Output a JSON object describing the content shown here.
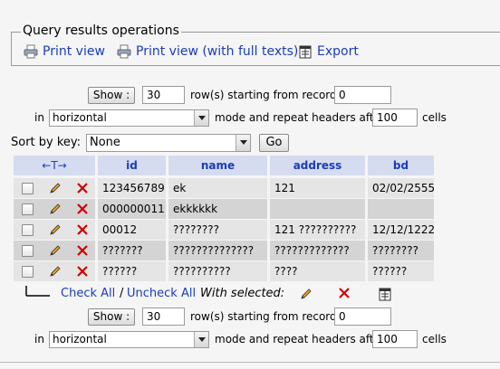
{
  "operations": {
    "legend": "Query results operations",
    "print_view": "Print view",
    "print_full": "Print view (with full texts)",
    "export": "Export"
  },
  "nav_top": {
    "show_label": "Show :",
    "rows_value": "30",
    "starting_text": "row(s) starting from record #",
    "start_value": "0",
    "in_text": "in",
    "mode_value": "horizontal",
    "mode_text": "mode and repeat headers after",
    "repeat_value": "100",
    "cells_text": "cells"
  },
  "sort": {
    "label": "Sort by key:",
    "value": "None",
    "go_label": "Go"
  },
  "table": {
    "headers": [
      "id",
      "name",
      "address",
      "bd"
    ],
    "rows": [
      [
        "123456789",
        "ek",
        "121",
        "02/02/2555"
      ],
      [
        "000000011",
        "ekkkkkk",
        "",
        ""
      ],
      [
        "00012",
        "????????",
        "121 ??????????",
        "12/12/1222"
      ],
      [
        "???????",
        "??????????????",
        "?????????????",
        "????????"
      ],
      [
        "??????",
        "??????????",
        "????",
        "??????"
      ]
    ]
  },
  "footer": {
    "check_all": "Check All",
    "separator": "/",
    "uncheck_all": "Uncheck All",
    "with_selected": "With selected:"
  },
  "nav_bottom": {
    "show_label": "Show :",
    "rows_value": "30",
    "starting_text": "row(s) starting from record #",
    "start_value": "0",
    "in_text": "in",
    "mode_value": "horizontal",
    "mode_text": "mode and repeat headers after",
    "repeat_value": "100",
    "cells_text": "cells"
  },
  "colors": {
    "link": "#1a3db8",
    "header_bg": "#d5dcf0",
    "row_light": "#e5e5e5",
    "row_dark": "#d4d4d4",
    "delete_red": "#d00000"
  },
  "icons": {
    "print": "printer-icon",
    "export": "export-icon",
    "edit": "pencil-icon",
    "delete": "delete-x-icon",
    "sort_arrows": "left-right-arrows-icon",
    "select_arrow": "corner-arrow-icon"
  }
}
